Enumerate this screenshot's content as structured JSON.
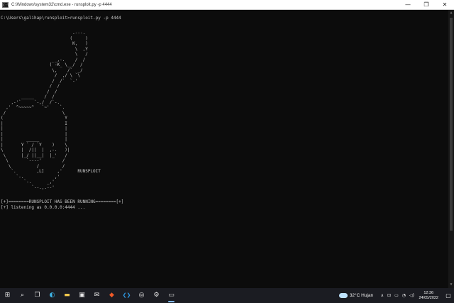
{
  "window": {
    "title": "C:\\Windows\\system32\\cmd.exe - runsploit.py  -p 4444",
    "app_icon_glyph": "C:\\",
    "minimize_glyph": "—",
    "maximize_glyph": "❐",
    "close_glyph": "✕"
  },
  "console": {
    "command_line": "C:\\Users\\galihap\\runsploit>runsploit.py -p 4444",
    "ascii_art": "                            .---.\n                           (     )\n                            K,   )\n                             \\  ,Y\n                             \\   /\n                     _,-.    /  /\n                   (`-K_ \\__/  /\n                    \\,    /`  _/\n                     /  ,/ \\ `\\\n                    /  /`  `-'\n                   /  /\n                  /  /\n        _____    /  /\n    ,-'`     `-,/  /`-.\n  ,'  ^~~~~~^   `~'    `.\n /                      \\\n(                        Y\n|                        I\n|                        |\n|                        |\n|         _____          |\n|       Y ` / `Y    )    \\\n\\       |  /||  |  ,-.   )|\n \\      |_/ ||__|  |_'   /\n  \\       `----'        /\n   \\          /         /\n    `.        ,L]     ,'      RUNSPLOIT\n      `-.            ,'\n         `-.      _,'\n            `--.,.--'",
    "output_lines": [
      "[+]========RUNSPLOIT HAS BEEN RUNNING========[+]",
      "[+] listening as 0.0.0.0:4444 ..."
    ]
  },
  "scrollbar": {
    "up_glyph": "▲",
    "down_glyph": "▼"
  },
  "taskbar": {
    "icons": [
      {
        "name": "start",
        "glyph": "⊞"
      },
      {
        "name": "search",
        "glyph": "⌕"
      },
      {
        "name": "task-view",
        "glyph": "❐"
      },
      {
        "name": "edge",
        "glyph": "◐"
      },
      {
        "name": "explorer",
        "glyph": "▬"
      },
      {
        "name": "store",
        "glyph": "▣"
      },
      {
        "name": "mail",
        "glyph": "✉"
      },
      {
        "name": "brave",
        "glyph": "◆"
      },
      {
        "name": "vscode",
        "glyph": "❮❯"
      },
      {
        "name": "browser",
        "glyph": "◎"
      },
      {
        "name": "settings",
        "glyph": "⚙"
      },
      {
        "name": "terminal",
        "glyph": "▭"
      }
    ],
    "weather": {
      "temperature": "32°C",
      "condition": "Hujan"
    },
    "tray_glyphs": {
      "chevron": "∧",
      "network": "⊡",
      "battery": "▭",
      "wifi": "◔",
      "volume": "◁)"
    },
    "clock": {
      "time": "12:36",
      "date": "24/05/2022"
    },
    "notification_glyph": "▢"
  }
}
